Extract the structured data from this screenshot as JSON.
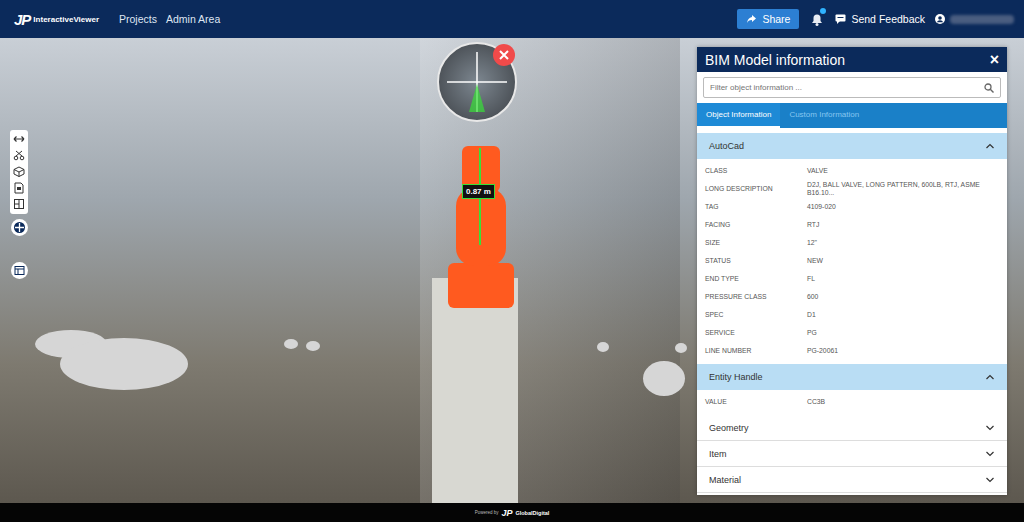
{
  "app": {
    "logo_mark": "JP",
    "logo_text": "InteractiveViewer"
  },
  "nav": [
    {
      "label": "Projects"
    },
    {
      "label": "Admin Area"
    }
  ],
  "actions": {
    "share": "Share",
    "notification_dot": true,
    "feedback": "Send Feedback"
  },
  "viewer": {
    "measurement": "0.87 m"
  },
  "panel": {
    "title": "BIM Model information",
    "close": "×",
    "search": {
      "placeholder": "Filter object information ..."
    },
    "tabs": [
      {
        "label": "Object Information",
        "selected": true
      },
      {
        "label": "Custom Information",
        "selected": false
      }
    ],
    "sections": [
      {
        "title": "AutoCad",
        "expanded": true,
        "rows": [
          {
            "label": "CLASS",
            "value": "VALVE"
          },
          {
            "label": "LONG DESCRIPTION",
            "value": "D2J, BALL VALVE, LONG PATTERN, 600LB, RTJ, ASME B16.10..."
          },
          {
            "label": "TAG",
            "value": "4109-020"
          },
          {
            "label": "FACING",
            "value": "RTJ"
          },
          {
            "label": "SIZE",
            "value": "12\""
          },
          {
            "label": "STATUS",
            "value": "NEW"
          },
          {
            "label": "END TYPE",
            "value": "FL"
          },
          {
            "label": "PRESSURE CLASS",
            "value": "600"
          },
          {
            "label": "SPEC",
            "value": "D1"
          },
          {
            "label": "SERVICE",
            "value": "PG"
          },
          {
            "label": "LINE NUMBER",
            "value": "PG-20061"
          }
        ]
      },
      {
        "title": "Entity Handle",
        "expanded": true,
        "rows": [
          {
            "label": "VALUE",
            "value": "CC3B"
          }
        ]
      },
      {
        "title": "Geometry",
        "expanded": false,
        "rows": []
      },
      {
        "title": "Item",
        "expanded": false,
        "rows": []
      },
      {
        "title": "Material",
        "expanded": false,
        "rows": []
      }
    ]
  },
  "footer": {
    "powered": "Powered by",
    "mark": "JP",
    "brand": "GlobalDigital"
  }
}
